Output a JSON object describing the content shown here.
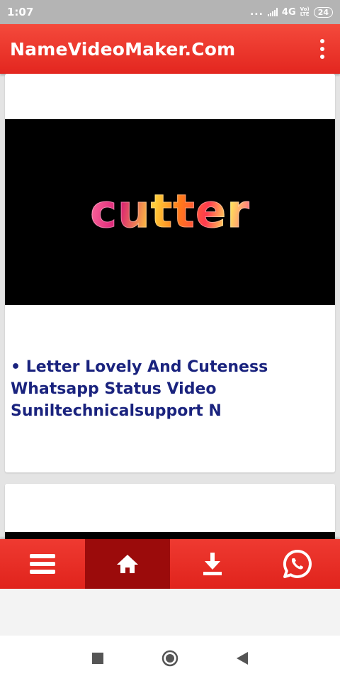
{
  "status_bar": {
    "time": "1:07",
    "signal_dots": "...",
    "network": "4G",
    "volte_top": "Vo)",
    "volte_bottom": "LTE",
    "battery": "24"
  },
  "app_bar": {
    "title": "NameVideoMaker.Com",
    "menu_icon": "more-vert-icon"
  },
  "feed": [
    {
      "thumbnail_text": "cutter",
      "title": "• Letter Lovely And Cuteness Whatsapp Status Video Suniltechnicalsupport N"
    }
  ],
  "bottom_nav": {
    "items": [
      {
        "icon": "menu-icon",
        "active": false
      },
      {
        "icon": "home-icon",
        "active": true
      },
      {
        "icon": "download-icon",
        "active": false
      },
      {
        "icon": "whatsapp-icon",
        "active": false
      }
    ]
  },
  "system_nav": [
    "recents-icon",
    "home-circle-icon",
    "back-icon"
  ],
  "colors": {
    "primary": "#e3261f",
    "active_nav": "#9b0b0b",
    "title_text": "#1a237e"
  }
}
